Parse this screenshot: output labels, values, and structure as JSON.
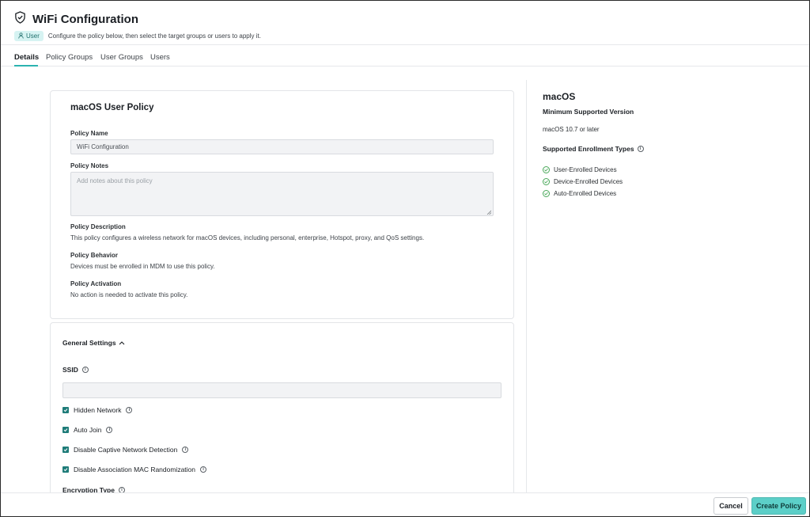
{
  "header": {
    "title": "WiFi Configuration",
    "badge": "User",
    "subtitle": "Configure the policy below, then select the target groups or users to apply it."
  },
  "tabs": [
    {
      "label": "Details",
      "active": true
    },
    {
      "label": "Policy Groups",
      "active": false
    },
    {
      "label": "User Groups",
      "active": false
    },
    {
      "label": "Users",
      "active": false
    }
  ],
  "policy_card": {
    "title": "macOS User Policy",
    "name_label": "Policy Name",
    "name_value": "WiFi Configuration",
    "notes_label": "Policy Notes",
    "notes_placeholder": "Add notes about this policy",
    "description_label": "Policy Description",
    "description_text": "This policy configures a wireless network for macOS devices, including personal, enterprise, Hotspot, proxy, and QoS settings.",
    "behavior_label": "Policy Behavior",
    "behavior_text": "Devices must be enrolled in MDM to use this policy.",
    "activation_label": "Policy Activation",
    "activation_text": "No action is needed to activate this policy."
  },
  "general_settings": {
    "title": "General Settings",
    "ssid_label": "SSID",
    "ssid_value": "",
    "checkboxes": [
      {
        "label": "Hidden Network",
        "checked": true
      },
      {
        "label": "Auto Join",
        "checked": true
      },
      {
        "label": "Disable Captive Network Detection",
        "checked": true
      },
      {
        "label": "Disable Association MAC Randomization",
        "checked": true
      }
    ],
    "encryption_label": "Encryption Type"
  },
  "side_panel": {
    "title": "macOS",
    "min_version_label": "Minimum Supported Version",
    "min_version_value": "macOS 10.7 or later",
    "enrollment_label": "Supported Enrollment Types",
    "enrollment_types": [
      "User-Enrolled Devices",
      "Device-Enrolled Devices",
      "Auto-Enrolled Devices"
    ]
  },
  "footer": {
    "cancel_label": "Cancel",
    "create_label": "Create Policy"
  },
  "colors": {
    "accent": "#2bb3b0",
    "primary_button": "#5ccfc8",
    "checkbox": "#1f7c79",
    "success": "#4aa85a"
  }
}
